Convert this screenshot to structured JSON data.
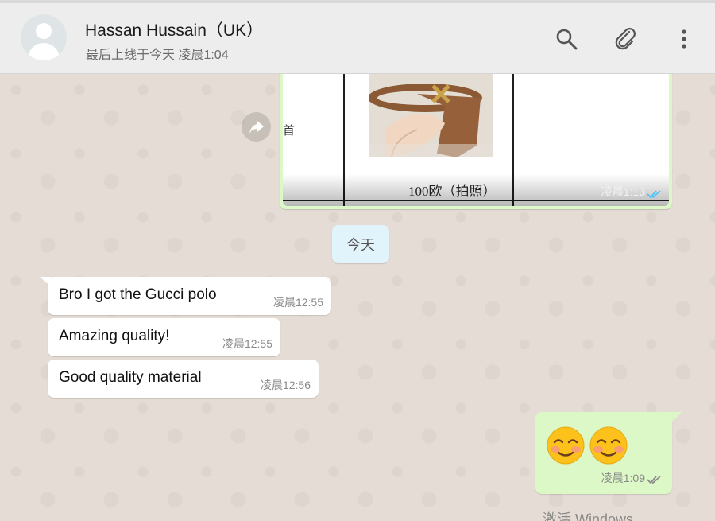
{
  "header": {
    "contact_name": "Hassan Hussain（UK）",
    "last_seen": "最后上线于今天 凌晨1:04",
    "icons": [
      "search-icon",
      "attach-icon",
      "more-vert-icon"
    ]
  },
  "image_message": {
    "caption": "100欧（拍照）",
    "time": "凌晨1:13",
    "status": "read",
    "partial_text": "首"
  },
  "date_divider": "今天",
  "incoming_messages": [
    {
      "text": "Bro I got the Gucci polo",
      "time": "凌晨12:55"
    },
    {
      "text": "Amazing quality!",
      "time": "凌晨12:55"
    },
    {
      "text": "Good quality material",
      "time": "凌晨12:56"
    }
  ],
  "outgoing_emoji_message": {
    "emoji": [
      "smiling-face-icon",
      "smiling-face-icon"
    ],
    "time": "凌晨1:09",
    "status": "delivered"
  },
  "watermark": "激活 Windows",
  "colors": {
    "chat_bg": "#e5ddd5",
    "outgoing_bubble": "#dcf8c6",
    "incoming_bubble": "#ffffff",
    "date_chip": "#e1f3fb",
    "read_ticks": "#4fc3f7"
  }
}
